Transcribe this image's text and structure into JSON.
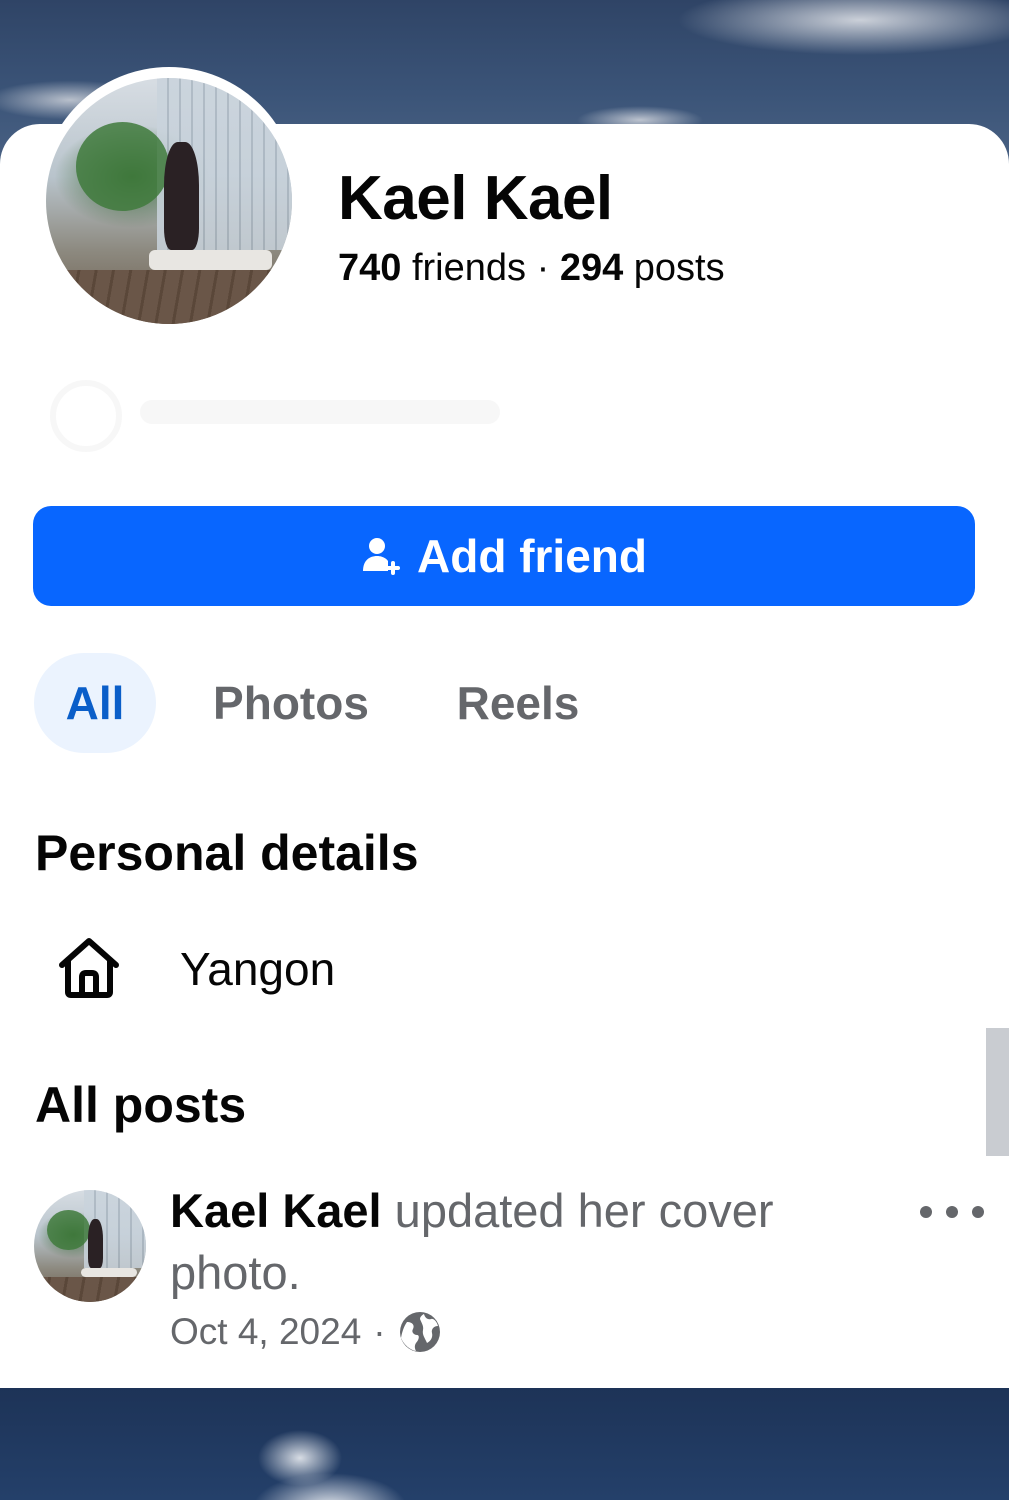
{
  "profile": {
    "name": "Kael Kael",
    "friends_count": "740",
    "friends_label": "friends",
    "separator": "·",
    "posts_count": "294",
    "posts_label": "posts"
  },
  "actions": {
    "add_friend_label": "Add friend",
    "add_friend_icon": "add-person-icon"
  },
  "tabs": [
    {
      "label": "All",
      "selected": true
    },
    {
      "label": "Photos",
      "selected": false
    },
    {
      "label": "Reels",
      "selected": false
    }
  ],
  "personal_details": {
    "title": "Personal details",
    "items": [
      {
        "icon": "home-icon",
        "text": "Yangon"
      }
    ]
  },
  "posts": {
    "title": "All posts",
    "items": [
      {
        "author": "Kael Kael",
        "action": " updated her cover photo.",
        "date": "Oct 4, 2024",
        "separator": "·",
        "audience_icon": "globe-icon",
        "menu_icon": "more-options-icon"
      }
    ]
  },
  "colors": {
    "primary": "#0866ff",
    "selected_tab_bg": "#ebf3fe",
    "selected_tab_text": "#0a5ec9",
    "secondary_text": "#65676b",
    "primary_text": "#050505"
  }
}
